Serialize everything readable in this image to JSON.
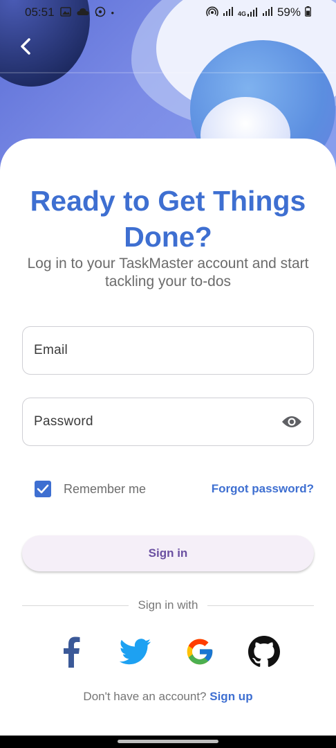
{
  "status_bar": {
    "time": "05:51",
    "battery": "59%",
    "network": "4G",
    "left_icons": [
      "gallery-icon",
      "cloud-icon",
      "whatsapp-icon",
      "dot-icon"
    ],
    "right_icons": [
      "hotspot-icon",
      "signal-icon",
      "signal-4g-icon",
      "signal-icon",
      "battery-icon"
    ]
  },
  "header": {
    "back_icon": "chevron-left-icon"
  },
  "login": {
    "title": "Ready to Get Things Done?",
    "subtitle": "Log in to your TaskMaster account and start tackling your to-dos",
    "email_placeholder": "Email",
    "password_placeholder": "Password",
    "remember_label": "Remember me",
    "remember_checked": true,
    "forgot_label": "Forgot password?",
    "signin_label": "Sign in",
    "divider_label": "Sign in with",
    "signup_prompt": "Don't have an account?",
    "signup_link": "Sign up"
  },
  "social": [
    "facebook",
    "twitter",
    "google",
    "github"
  ],
  "colors": {
    "accent": "#3e6fd1",
    "button_bg": "#f5eff8",
    "button_text": "#6a4fa1"
  }
}
